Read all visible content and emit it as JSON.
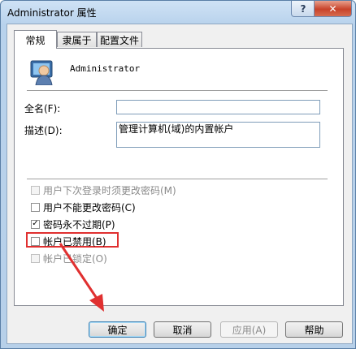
{
  "window": {
    "title": "Administrator 属性",
    "help_glyph": "?",
    "close_glyph": "✕"
  },
  "tabs": [
    {
      "label": "常规",
      "active": true
    },
    {
      "label": "隶属于",
      "active": false
    },
    {
      "label": "配置文件",
      "active": false
    }
  ],
  "user": {
    "name": "Administrator",
    "icon": "user-avatar-icon"
  },
  "fields": {
    "fullname_label": "全名(F):",
    "fullname_value": "",
    "description_label": "描述(D):",
    "description_value": "管理计算机(域)的内置帐户"
  },
  "checkboxes": [
    {
      "label": "用户下次登录时须更改密码(M)",
      "checked": false,
      "enabled": false
    },
    {
      "label": "用户不能更改密码(C)",
      "checked": false,
      "enabled": true
    },
    {
      "label": "密码永不过期(P)",
      "checked": true,
      "enabled": true
    },
    {
      "label": "帐户已禁用(B)",
      "checked": false,
      "enabled": true,
      "highlighted": true
    },
    {
      "label": "帐户已锁定(O)",
      "checked": false,
      "enabled": false
    }
  ],
  "check_glyph": "✓",
  "buttons": {
    "ok": "确定",
    "cancel": "取消",
    "apply": "应用(A)",
    "help": "帮助"
  },
  "colors": {
    "highlight": "#e03030",
    "arrow": "#e03030"
  }
}
